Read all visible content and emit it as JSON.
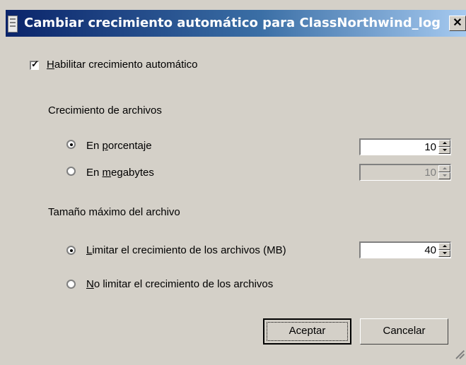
{
  "window": {
    "title": "Cambiar crecimiento automático para ClassNorthwind_log",
    "close_glyph": "✕"
  },
  "enable_autogrowth": {
    "checked": true,
    "label_access_key": "H",
    "label_rest": "abilitar crecimiento automático"
  },
  "file_growth": {
    "heading": "Crecimiento de archivos",
    "percent": {
      "selected": true,
      "prefix": "En ",
      "access_key": "p",
      "suffix": "orcentaje",
      "value": "10"
    },
    "megabytes": {
      "selected": false,
      "prefix": "En ",
      "access_key": "m",
      "suffix": "egabytes",
      "value": "10",
      "enabled": false
    }
  },
  "max_file_size": {
    "heading": "Tamaño máximo del archivo",
    "limited": {
      "selected": true,
      "access_key": "L",
      "rest": "imitar el crecimiento de los archivos (MB)",
      "value": "40"
    },
    "unlimited": {
      "selected": false,
      "access_key": "N",
      "rest": "o limitar el crecimiento de los archivos"
    }
  },
  "buttons": {
    "ok": "Aceptar",
    "cancel": "Cancelar"
  },
  "icons": {
    "window_icon": "document-window-icon",
    "close_icon": "close-icon",
    "spin_up": "spin-up-arrow-icon",
    "spin_down": "spin-down-arrow-icon",
    "grip": "resize-grip-icon"
  },
  "colors": {
    "face": "#d4d0c8",
    "titlebar_start": "#0a246a",
    "titlebar_end": "#a6caf0"
  }
}
